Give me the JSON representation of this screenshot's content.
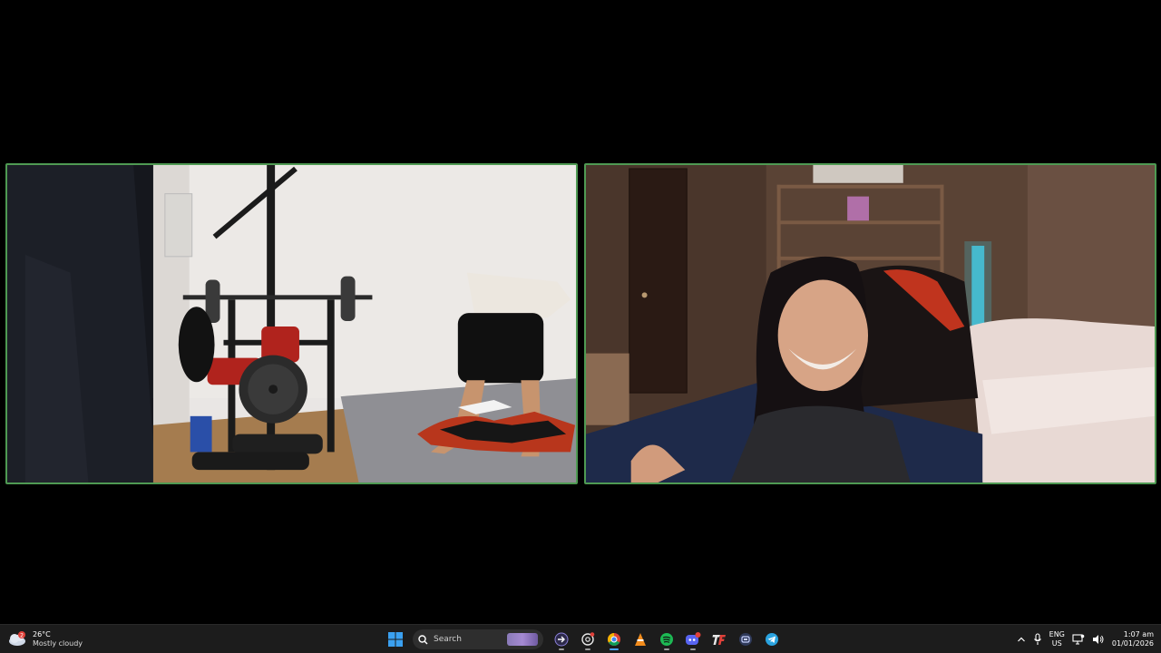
{
  "taskbar": {
    "weather": {
      "temp": "26°C",
      "condition": "Mostly cloudy",
      "icon": "cloud-icon",
      "badge": "2"
    },
    "search_label": "Search",
    "pinned": [
      {
        "name": "start-icon"
      },
      {
        "name": "search-box"
      },
      {
        "name": "app-arrow-icon"
      },
      {
        "name": "app-chatgpt-icon"
      },
      {
        "name": "chrome-icon"
      },
      {
        "name": "vlc-icon"
      },
      {
        "name": "spotify-icon"
      },
      {
        "name": "discord-icon"
      },
      {
        "name": "tf-icon"
      },
      {
        "name": "app-box-icon"
      },
      {
        "name": "telegram-icon"
      }
    ],
    "language": {
      "top": "ENG",
      "bottom": "US"
    },
    "clock": {
      "time": "1:07 am",
      "date": "01/01/2026"
    }
  },
  "colors": {
    "tile_border": "#4f9a53",
    "taskbar_bg": "#1c1c1c",
    "accent": "#0078d4"
  }
}
